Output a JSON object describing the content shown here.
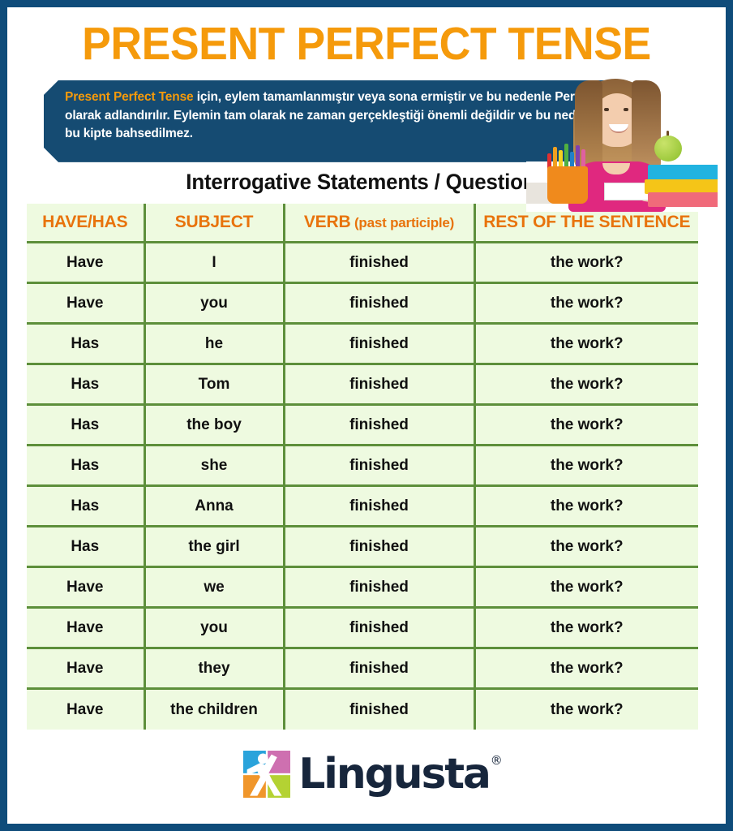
{
  "header": {
    "title": "PRESENT PERFECT TENSE",
    "title_color": "#F59A0B"
  },
  "description": {
    "highlight": "Present Perfect Tense",
    "body": " için, eylem tamamlanmıştır veya sona ermiştir ve bu nedenle Perfect olarak adlandırılır. Eylemin tam olarak ne zaman gerçekleştiği önemli değildir ve bu nedenle, bu kipte bahsedilmez.",
    "panel_color": "#154b72",
    "highlight_color": "#F59A0B"
  },
  "subtitle": "Interrogative Statements / Questions",
  "table": {
    "header_color": "#E8730C",
    "border_color": "#5d8f3b",
    "cell_background": "#eefae0",
    "columns": [
      {
        "label": "HAVE/HAS"
      },
      {
        "label": "SUBJECT"
      },
      {
        "label_main": "VERB",
        "label_sub": " (past participle)"
      },
      {
        "label": "REST OF THE SENTENCE"
      }
    ],
    "rows": [
      {
        "aux": "Have",
        "subject": "I",
        "verb": "finished",
        "rest": "the work?"
      },
      {
        "aux": "Have",
        "subject": "you",
        "verb": "finished",
        "rest": "the work?"
      },
      {
        "aux": "Has",
        "subject": "he",
        "verb": "finished",
        "rest": "the work?"
      },
      {
        "aux": "Has",
        "subject": "Tom",
        "verb": "finished",
        "rest": "the work?"
      },
      {
        "aux": "Has",
        "subject": "the boy",
        "verb": "finished",
        "rest": "the work?"
      },
      {
        "aux": "Has",
        "subject": "she",
        "verb": "finished",
        "rest": "the work?"
      },
      {
        "aux": "Has",
        "subject": "Anna",
        "verb": "finished",
        "rest": "the work?"
      },
      {
        "aux": "Has",
        "subject": "the girl",
        "verb": "finished",
        "rest": "the work?"
      },
      {
        "aux": "Have",
        "subject": "we",
        "verb": "finished",
        "rest": "the work?"
      },
      {
        "aux": "Have",
        "subject": "you",
        "verb": "finished",
        "rest": "the work?"
      },
      {
        "aux": "Have",
        "subject": "they",
        "verb": "finished",
        "rest": "the work?"
      },
      {
        "aux": "Have",
        "subject": "the children",
        "verb": "finished",
        "rest": "the work?"
      }
    ]
  },
  "footer": {
    "brand": "Lingusta",
    "registered_mark": "®",
    "brand_color": "#17263c",
    "logo_colors": {
      "blue": "#2AA3DB",
      "pink": "#CE70B0",
      "orange": "#F0962B",
      "green": "#B4D233"
    }
  },
  "frame": {
    "border_color": "#0f4c7a"
  }
}
